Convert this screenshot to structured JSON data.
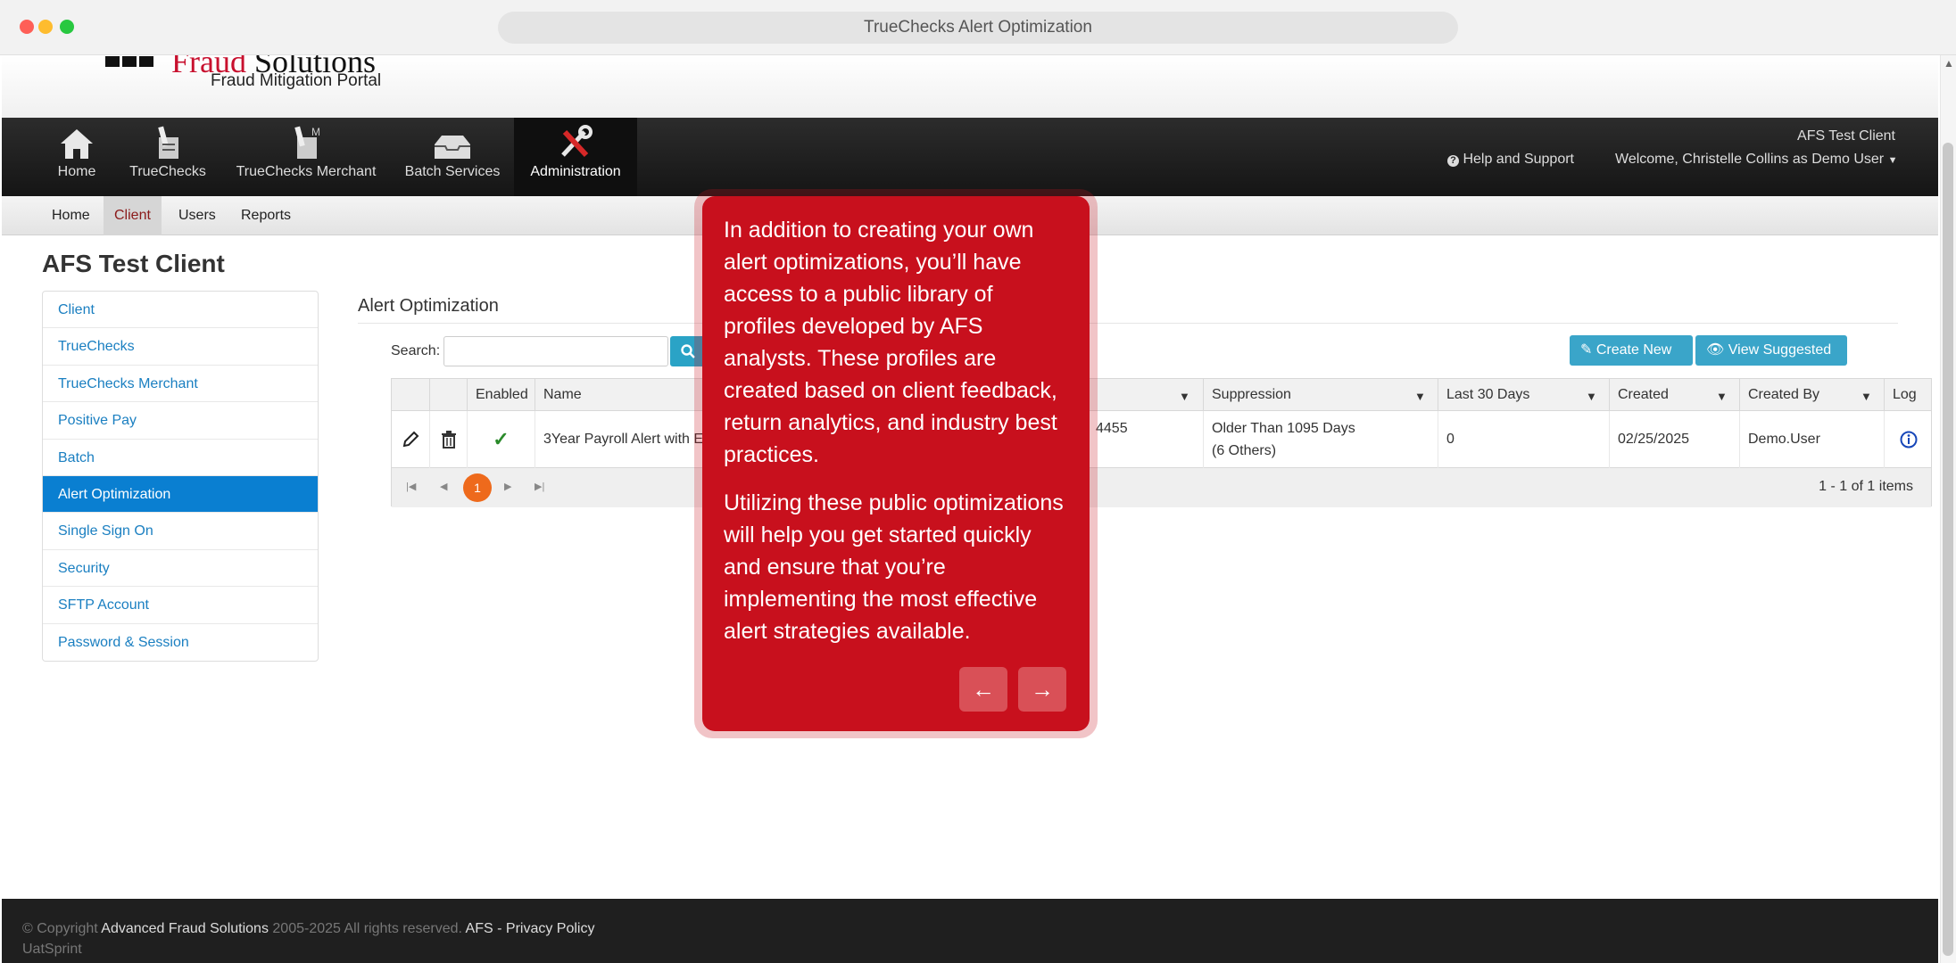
{
  "browser": {
    "url_title": "TrueChecks Alert Optimization"
  },
  "header": {
    "logo_title_prefix": "Fraud",
    "logo_title_suffix": "Solutions",
    "logo_subtitle": "Fraud Mitigation Portal"
  },
  "nav": {
    "items": [
      {
        "label": "Home",
        "icon": "home-icon"
      },
      {
        "label": "TrueChecks",
        "icon": "check-icon"
      },
      {
        "label": "TrueChecks Merchant",
        "icon": "merchant-check-icon"
      },
      {
        "label": "Batch Services",
        "icon": "inbox-tray-icon"
      },
      {
        "label": "Administration",
        "icon": "tools-icon"
      }
    ],
    "client_name": "AFS Test Client",
    "help": "Help and Support",
    "welcome": "Welcome, Christelle Collins as Demo User"
  },
  "subnav": {
    "items": [
      "Home",
      "Client",
      "Users",
      "Reports"
    ],
    "active": "Client"
  },
  "page_title": "AFS Test Client",
  "sidebar": {
    "items": [
      "Client",
      "TrueChecks",
      "TrueChecks Merchant",
      "Positive Pay",
      "Batch",
      "Alert Optimization",
      "Single Sign On",
      "Security",
      "SFTP Account",
      "Password & Session"
    ],
    "active": "Alert Optimization"
  },
  "content": {
    "section_title": "Alert Optimization",
    "search_label": "Search:",
    "search_value": "",
    "create_new": "Create New",
    "view_suggested": "View Suggested"
  },
  "grid": {
    "columns": [
      "",
      "",
      "Enabled",
      "Name",
      "Suppression",
      "Last 30 Days",
      "Created",
      "Created By",
      "Log"
    ],
    "rows": [
      {
        "enabled": "✓",
        "name": "3Year Payroll Alert with E",
        "partial_value": "4455",
        "suppression_line1": "Older Than 1095 Days",
        "suppression_line2": "(6 Others)",
        "last30": "0",
        "created": "02/25/2025",
        "created_by": "Demo.User"
      }
    ],
    "current_page": "1",
    "page_info": "1 - 1 of 1 items"
  },
  "callout": {
    "paragraph1": "In addition to creating your own alert optimizations, you’ll have access to a public library of profiles developed by AFS analysts. These profiles are created based on client feedback, return analytics, and industry best practices.",
    "paragraph2": "Utilizing these public optimizations will help you get started quickly and ensure that you’re implementing the most effective alert strategies available.",
    "prev": "←",
    "next": "→",
    "color": "#c8101d"
  },
  "footer": {
    "copyright": "© Copyright",
    "company": "Advanced Fraud Solutions",
    "years": "2005-2025 All rights reserved.",
    "afs": "AFS",
    "sep": " - ",
    "privacy": "Privacy Policy",
    "env": "UatSprint"
  }
}
